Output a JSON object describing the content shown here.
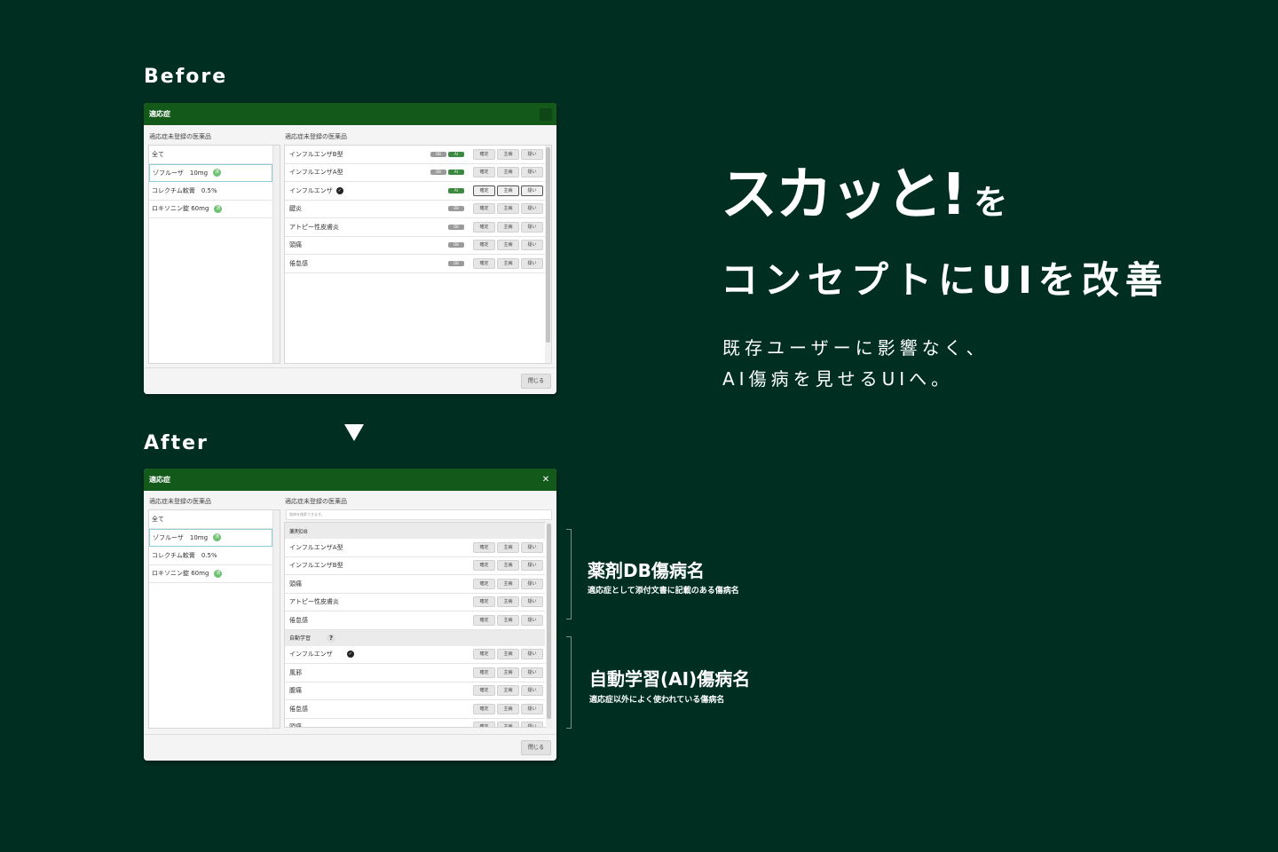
{
  "before": {
    "label": "Before",
    "dialog_title": "適応症",
    "left_title": "適応症未登録の医薬品",
    "right_title": "適応症未登録の医薬品",
    "left_items": [
      {
        "label": "全て",
        "badge": ""
      },
      {
        "label": "ゾフルーザ　10mg",
        "badge": "済"
      },
      {
        "label": "コレクチム軟膏　0.5%",
        "badge": ""
      },
      {
        "label": "ロキソニン錠 60mg",
        "badge": "済"
      }
    ],
    "rows": [
      {
        "name": "インフルエンザB型",
        "tags": [
          "DB",
          "AI"
        ],
        "check": false
      },
      {
        "name": "インフルエンザA型",
        "tags": [
          "DB",
          "AI"
        ],
        "check": false
      },
      {
        "name": "インフルエンザ",
        "tags": [
          "AI"
        ],
        "check": true
      },
      {
        "name": "腱炎",
        "tags": [
          "DB"
        ],
        "check": false
      },
      {
        "name": "アトピー性皮膚炎",
        "tags": [
          "DB"
        ],
        "check": false
      },
      {
        "name": "頭痛",
        "tags": [
          "DB"
        ],
        "check": false
      },
      {
        "name": "倦怠感",
        "tags": [
          "DB"
        ],
        "check": false
      }
    ],
    "buttons": [
      "確定",
      "主病",
      "疑い"
    ],
    "close_label": "閉じる"
  },
  "after": {
    "label": "After",
    "dialog_title": "適応症",
    "close_icon": "close-icon",
    "left_title": "適応症未登録の医薬品",
    "right_title": "適応症未登録の医薬品",
    "search_placeholder": "傷病を検索できます。",
    "left_items": [
      {
        "label": "全て",
        "badge": ""
      },
      {
        "label": "ゾフルーザ　10mg",
        "badge": "済"
      },
      {
        "label": "コレクチム軟膏　0.5%",
        "badge": ""
      },
      {
        "label": "ロキソニン錠 60mg",
        "badge": "済"
      }
    ],
    "section_db": "薬剤DB",
    "db_rows": [
      "インフルエンザA型",
      "インフルエンザB型",
      "頭痛",
      "アトピー性皮膚炎",
      "倦怠感"
    ],
    "section_ai": "自動学習",
    "ai_rows": [
      {
        "name": "インフルエンザ",
        "check": true
      },
      {
        "name": "風邪",
        "check": false
      },
      {
        "name": "腹痛",
        "check": false
      },
      {
        "name": "倦怠感",
        "check": false
      },
      {
        "name": "頭痛",
        "check": false
      }
    ],
    "buttons": [
      "確定",
      "主病",
      "疑い"
    ],
    "close_label": "閉じる"
  },
  "headline": {
    "main": "スカッと!",
    "suffix": "を",
    "line2": "コンセプトにUIを改善"
  },
  "description": {
    "line1": "既存ユーザーに影響なく、",
    "line2": "AI傷病を見せるUIへ。"
  },
  "annotations": {
    "db_title": "薬剤DB傷病名",
    "db_sub": "適応症として添付文書に記載のある傷病名",
    "ai_title": "自動学習(AI)傷病名",
    "ai_sub": "適応症以外によく使われている傷病名"
  },
  "colors": {
    "background": "#002f22",
    "dialog_header": "#12591a",
    "ai_tag": "#3b8a3f",
    "badge": "#6cc070"
  }
}
